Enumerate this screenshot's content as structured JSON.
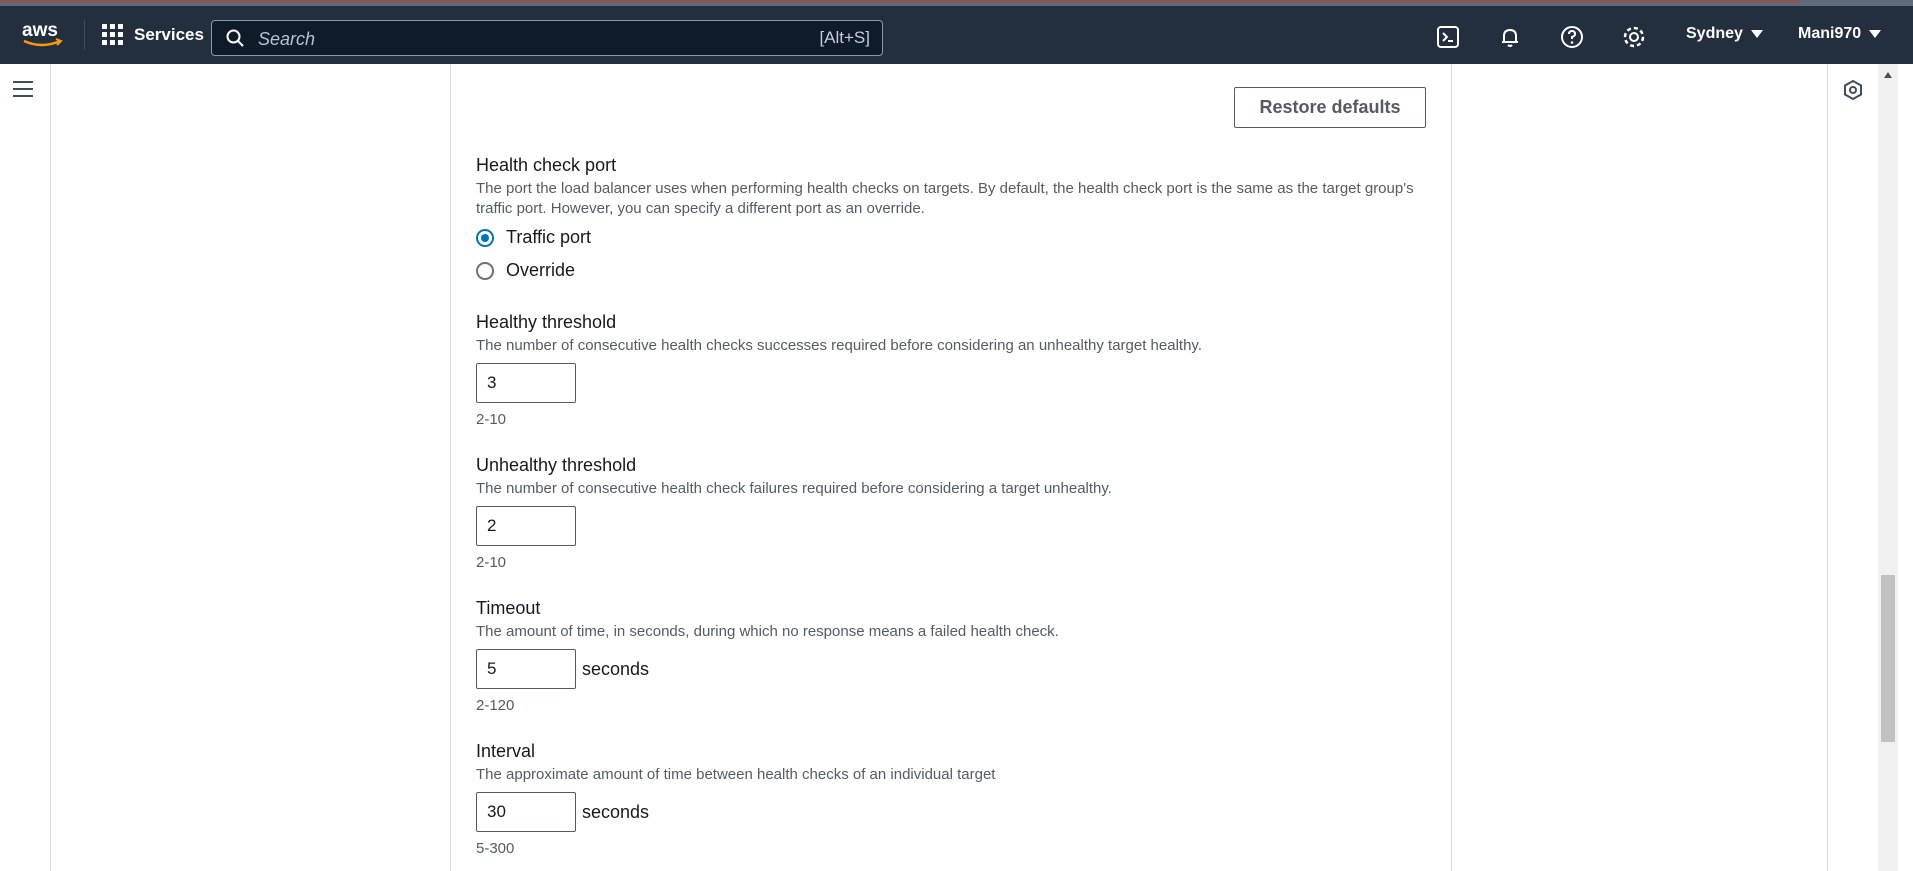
{
  "topbar": {
    "services_label": "Services",
    "search_placeholder": "Search",
    "search_shortcut": "[Alt+S]",
    "region": "Sydney",
    "account": "Mani970"
  },
  "panel": {
    "restore_defaults_label": "Restore defaults",
    "health_check_port": {
      "label": "Health check port",
      "description": "The port the load balancer uses when performing health checks on targets. By default, the health check port is the same as the target group's traffic port. However, you can specify a different port as an override.",
      "options": [
        {
          "label": "Traffic port",
          "selected": true
        },
        {
          "label": "Override",
          "selected": false
        }
      ]
    },
    "healthy_threshold": {
      "label": "Healthy threshold",
      "description": "The number of consecutive health checks successes required before considering an unhealthy target healthy.",
      "value": "3",
      "constraint": "2-10"
    },
    "unhealthy_threshold": {
      "label": "Unhealthy threshold",
      "description": "The number of consecutive health check failures required before considering a target unhealthy.",
      "value": "2",
      "constraint": "2-10"
    },
    "timeout": {
      "label": "Timeout",
      "description": "The amount of time, in seconds, during which no response means a failed health check.",
      "value": "5",
      "unit": "seconds",
      "constraint": "2-120"
    },
    "interval": {
      "label": "Interval",
      "description": "The approximate amount of time between health checks of an individual target",
      "value": "30",
      "unit": "seconds",
      "constraint": "5-300"
    }
  },
  "colors": {
    "topbar_bg": "#232f3e",
    "accent": "#0073bb",
    "aws_orange": "#ff9900"
  }
}
